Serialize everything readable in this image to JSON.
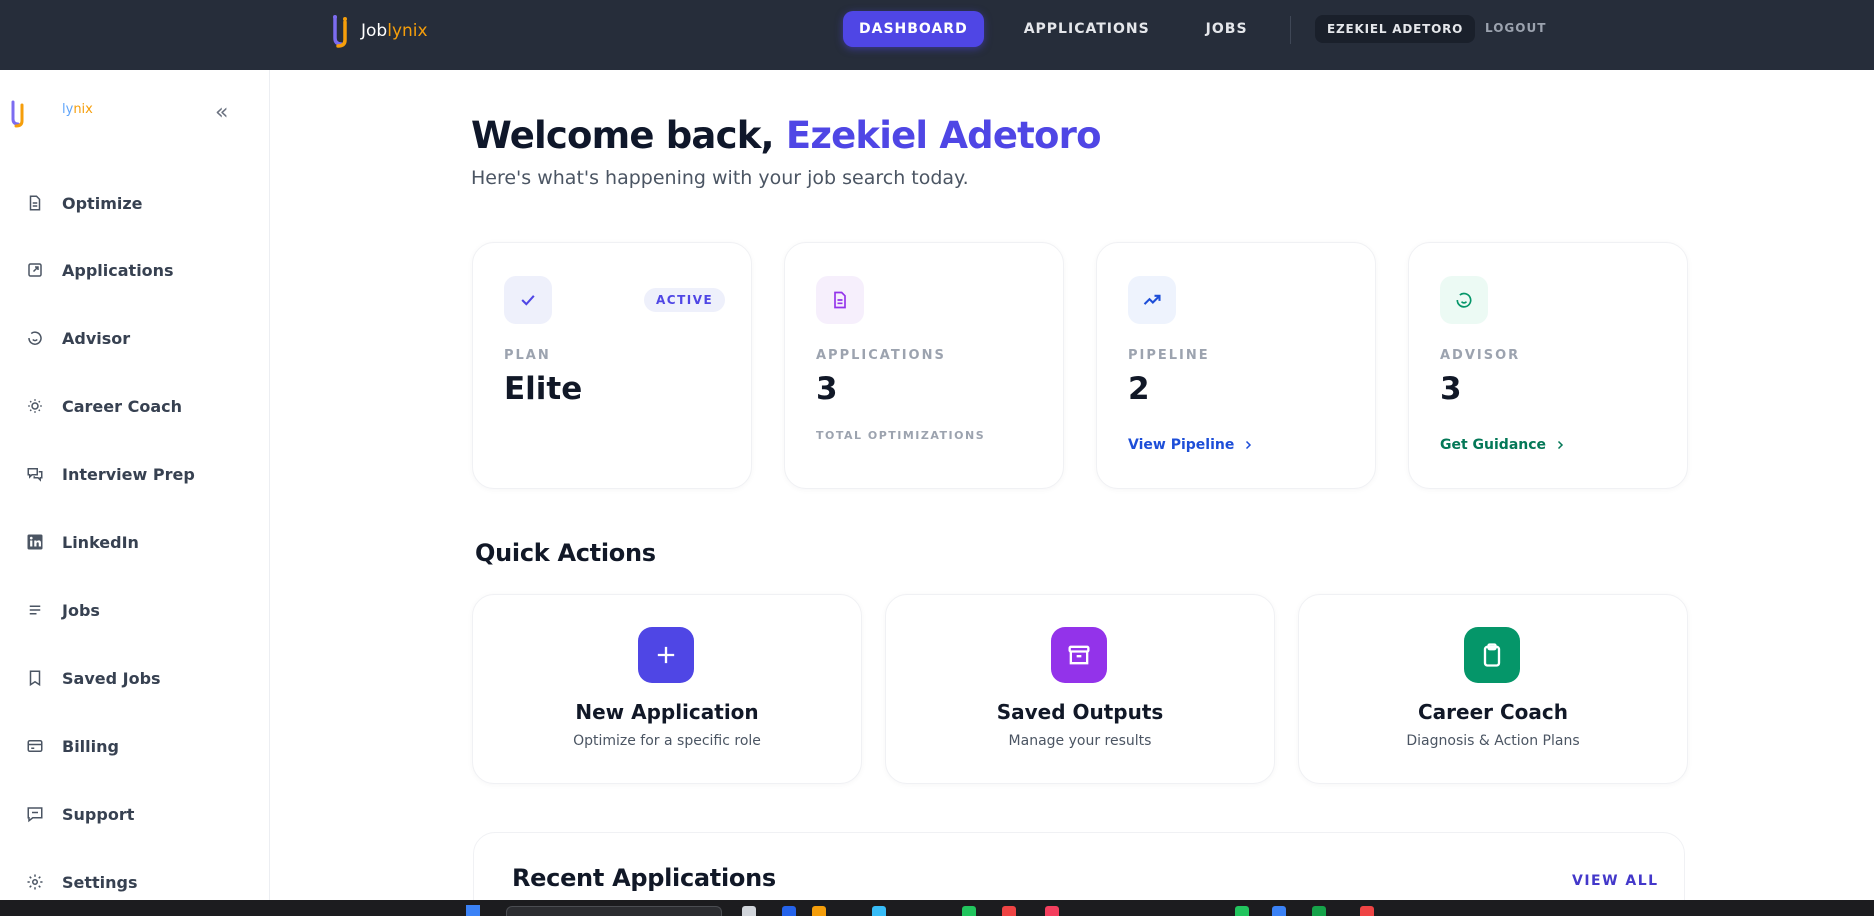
{
  "topbar": {
    "brand_prefix": "Job",
    "brand_accent": "lynix",
    "nav": [
      {
        "label": "DASHBOARD",
        "active": true
      },
      {
        "label": "APPLICATIONS",
        "active": false
      },
      {
        "label": "JOBS",
        "active": false
      }
    ],
    "user": "EZEKIEL ADETORO",
    "logout": "LOGOUT"
  },
  "sidebar": {
    "brand_a": "ly",
    "brand_b": "nix",
    "items": [
      {
        "label": "Optimize",
        "icon": "document-icon"
      },
      {
        "label": "Applications",
        "icon": "external-edit-icon"
      },
      {
        "label": "Advisor",
        "icon": "smile-icon"
      },
      {
        "label": "Career Coach",
        "icon": "lightbulb-icon"
      },
      {
        "label": "Interview Prep",
        "icon": "chat-bubbles-icon"
      },
      {
        "label": "LinkedIn",
        "icon": "linkedin-icon"
      },
      {
        "label": "Jobs",
        "icon": "lines-icon"
      },
      {
        "label": "Saved Jobs",
        "icon": "bookmark-icon"
      },
      {
        "label": "Billing",
        "icon": "credit-card-icon"
      },
      {
        "label": "Support",
        "icon": "message-square-icon"
      },
      {
        "label": "Settings",
        "icon": "gear-icon"
      }
    ]
  },
  "welcome": {
    "prefix": "Welcome back, ",
    "name": "Ezekiel Adetoro",
    "subtitle": "Here's what's happening with your job search today."
  },
  "stats": {
    "plan": {
      "label": "PLAN",
      "value": "Elite",
      "badge": "ACTIVE",
      "icon": "check-icon"
    },
    "applications": {
      "label": "APPLICATIONS",
      "value": "3",
      "sublabel": "TOTAL OPTIMIZATIONS",
      "icon": "document-icon"
    },
    "pipeline": {
      "label": "PIPELINE",
      "value": "2",
      "link": "View Pipeline",
      "icon": "trending-up-icon"
    },
    "advisor": {
      "label": "ADVISOR",
      "value": "3",
      "link": "Get Guidance",
      "icon": "smile-icon"
    }
  },
  "quick_actions": {
    "title": "Quick Actions",
    "items": [
      {
        "title": "New Application",
        "subtitle": "Optimize for a specific role",
        "icon": "plus-icon",
        "color": "#4f46e5"
      },
      {
        "title": "Saved Outputs",
        "subtitle": "Manage your results",
        "icon": "archive-icon",
        "color": "#9333ea"
      },
      {
        "title": "Career Coach",
        "subtitle": "Diagnosis & Action Plans",
        "icon": "clipboard-icon",
        "color": "#059669"
      }
    ]
  },
  "recent": {
    "title": "Recent Applications",
    "view_all": "VIEW ALL"
  },
  "colors": {
    "primary": "#4f46e5",
    "topbar": "#262d3a",
    "green": "#059669",
    "link_blue": "#1d4ed8"
  }
}
